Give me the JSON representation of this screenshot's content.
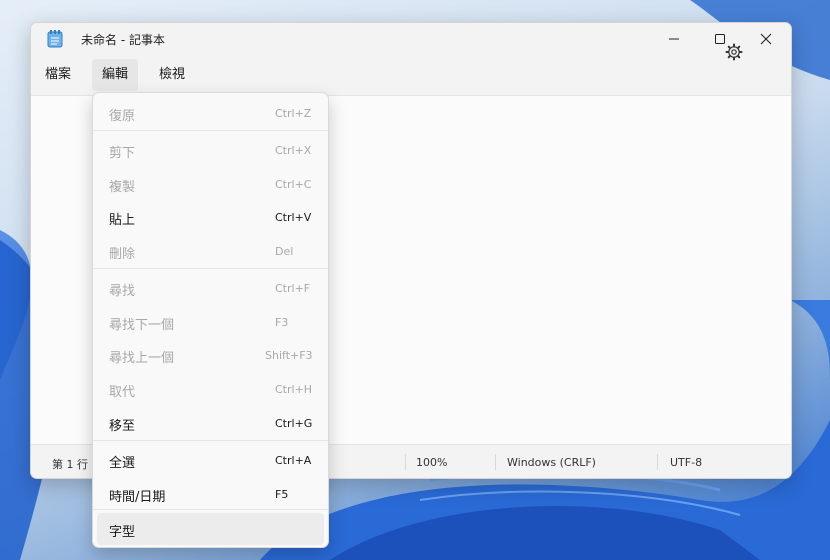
{
  "window": {
    "title": "未命名 - 記事本"
  },
  "menubar": {
    "items": [
      {
        "label": "檔案"
      },
      {
        "label": "編輯"
      },
      {
        "label": "檢視"
      }
    ]
  },
  "edit_menu": {
    "items": [
      {
        "label": "復原",
        "shortcut": "Ctrl+Z",
        "enabled": false
      },
      {
        "label": "剪下",
        "shortcut": "Ctrl+X",
        "enabled": false
      },
      {
        "label": "複製",
        "shortcut": "Ctrl+C",
        "enabled": false
      },
      {
        "label": "貼上",
        "shortcut": "Ctrl+V",
        "enabled": true
      },
      {
        "label": "刪除",
        "shortcut": "Del",
        "enabled": false
      },
      {
        "label": "尋找",
        "shortcut": "Ctrl+F",
        "enabled": false
      },
      {
        "label": "尋找下一個",
        "shortcut": "F3",
        "enabled": false
      },
      {
        "label": "尋找上一個",
        "shortcut": "Shift+F3",
        "enabled": false
      },
      {
        "label": "取代",
        "shortcut": "Ctrl+H",
        "enabled": false
      },
      {
        "label": "移至",
        "shortcut": "Ctrl+G",
        "enabled": true
      },
      {
        "label": "全選",
        "shortcut": "Ctrl+A",
        "enabled": true
      },
      {
        "label": "時間/日期",
        "shortcut": "F5",
        "enabled": true
      },
      {
        "label": "字型",
        "shortcut": "",
        "enabled": true
      }
    ]
  },
  "statusbar": {
    "position": "第 1 行",
    "zoom": "100%",
    "line_ending": "Windows (CRLF)",
    "encoding": "UTF-8"
  },
  "icons": {
    "app": "notepad-icon",
    "settings": "gear-icon",
    "minimize": "minimize-icon",
    "maximize": "maximize-icon",
    "close": "close-icon"
  },
  "colors": {
    "window_bg": "#f9f9f9",
    "disabled_text": "#a8a8a8",
    "wallpaper_accent": "#2f6fd0"
  }
}
